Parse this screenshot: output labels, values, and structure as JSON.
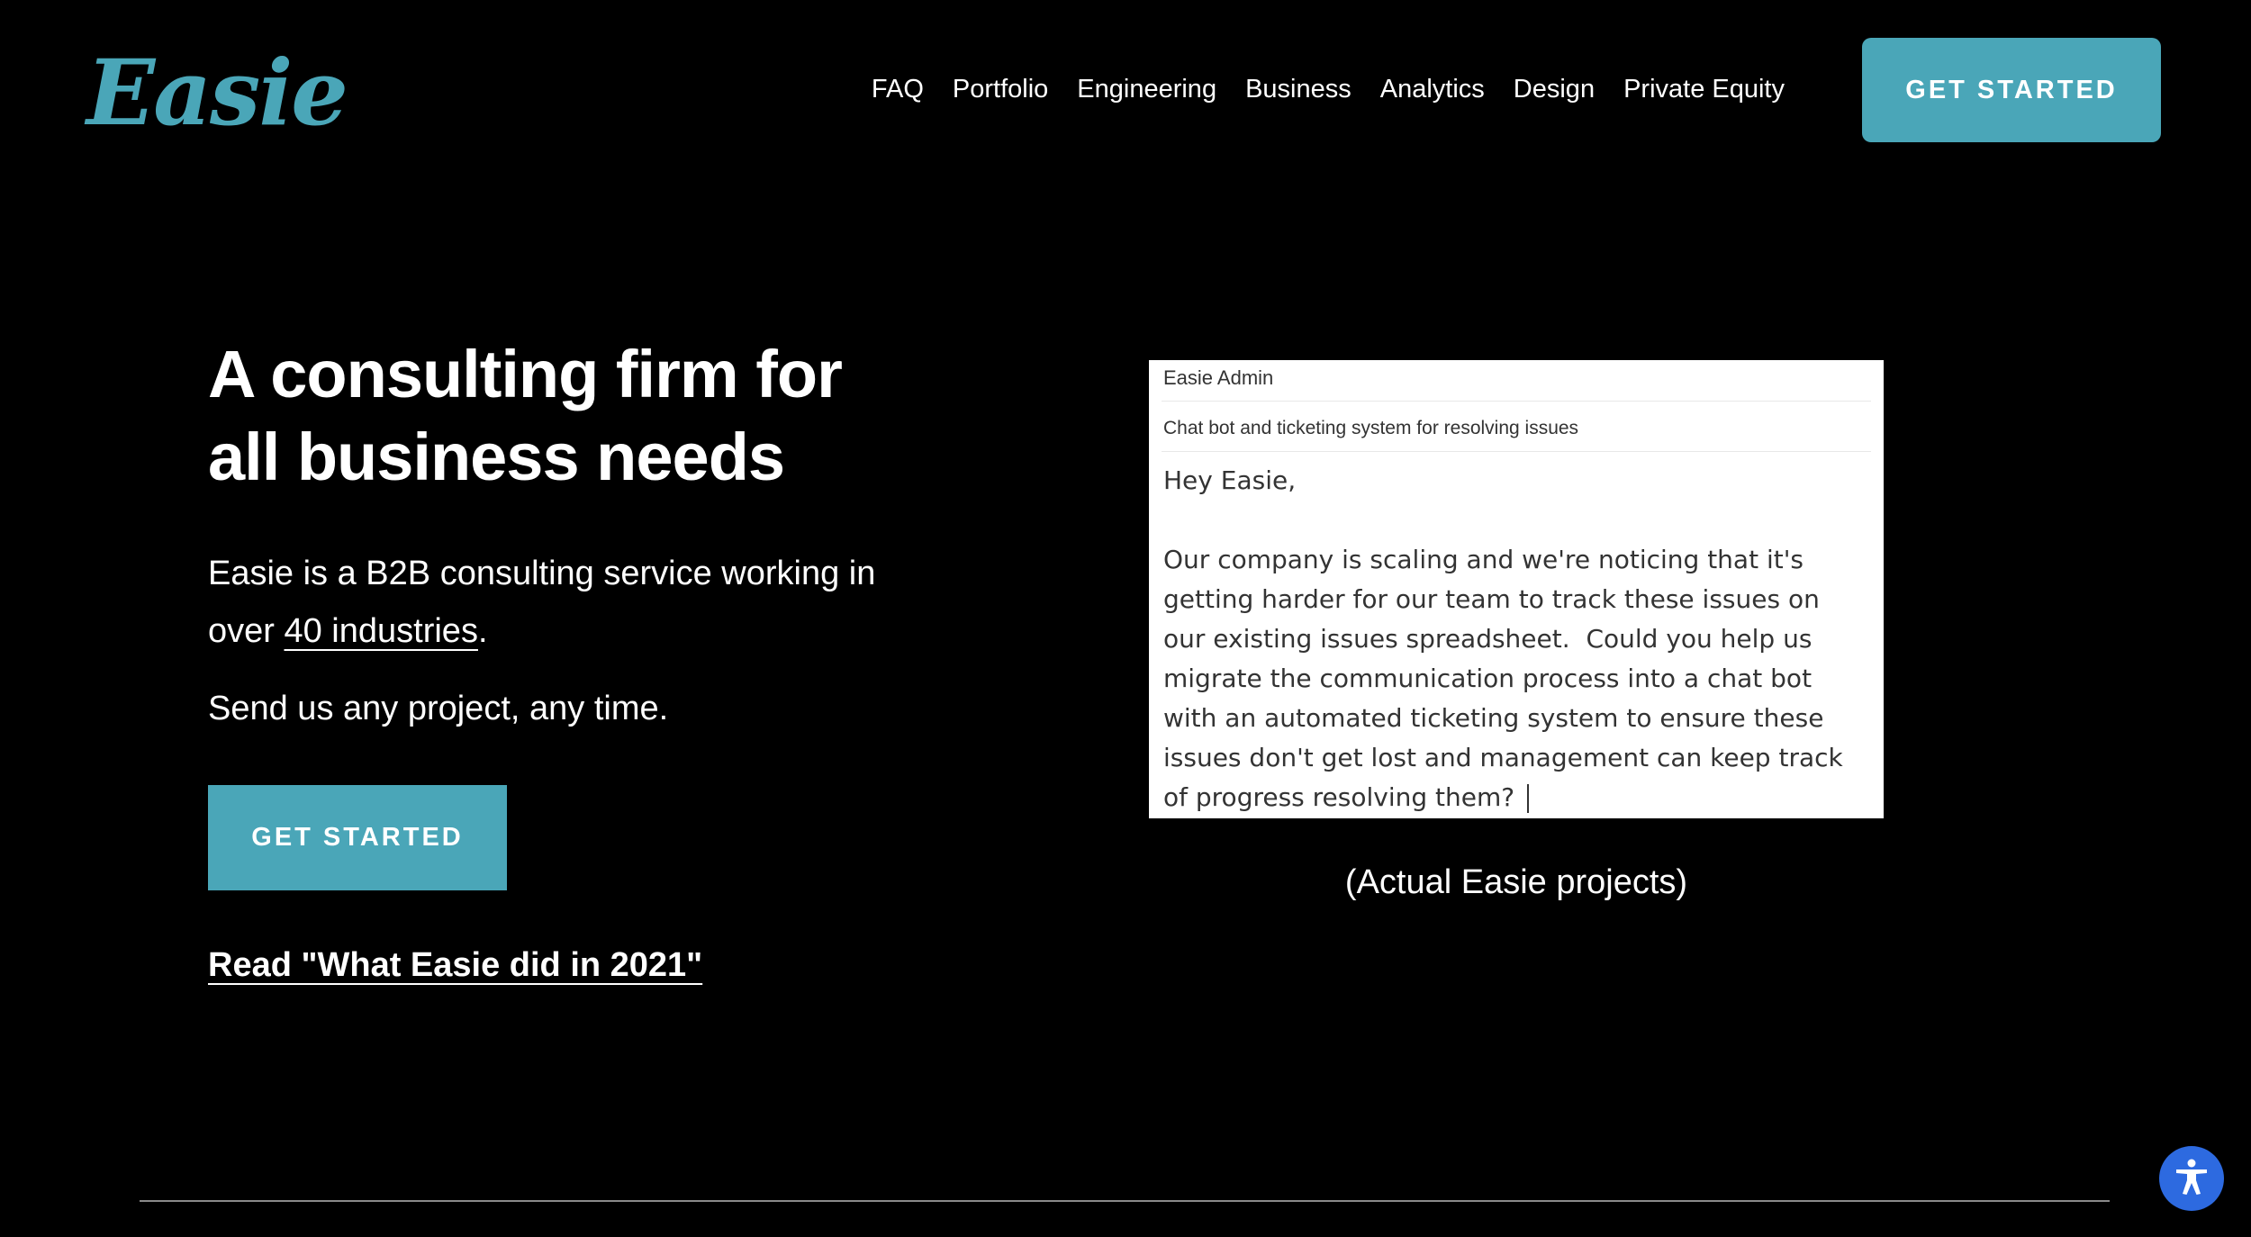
{
  "header": {
    "logo_text": "Easie",
    "nav": [
      "FAQ",
      "Portfolio",
      "Engineering",
      "Business",
      "Analytics",
      "Design",
      "Private Equity"
    ],
    "cta_label": "GET STARTED"
  },
  "hero": {
    "title_line1": "A consulting firm for",
    "title_line2": "all business needs",
    "desc_prefix": "Easie is a B2B consulting service working in over ",
    "desc_link": "40 industries",
    "desc_suffix": ".",
    "send_text": "Send us any project, any time.",
    "cta_label": "GET STARTED",
    "read_link": "Read \"What Easie did in 2021\""
  },
  "email_card": {
    "from": "Easie Admin",
    "subject": "Chat bot and ticketing system for resolving issues",
    "greeting": "Hey Easie,",
    "body_lines": [
      "Our company is scaling and we're noticing that it's",
      "getting harder for our team to track these issues on",
      "our existing issues spreadsheet.  Could you help us",
      "migrate the communication process into a chat bot",
      "with an automated ticketing system to ensure these",
      "issues don't get lost and management can keep track",
      "of progress resolving them?"
    ]
  },
  "caption": "(Actual Easie projects)",
  "accessibility": {
    "icon": "accessibility-icon"
  },
  "colors": {
    "background": "#000000",
    "accent": "#4aa6b8",
    "a11y_button": "#2d6ae0"
  }
}
